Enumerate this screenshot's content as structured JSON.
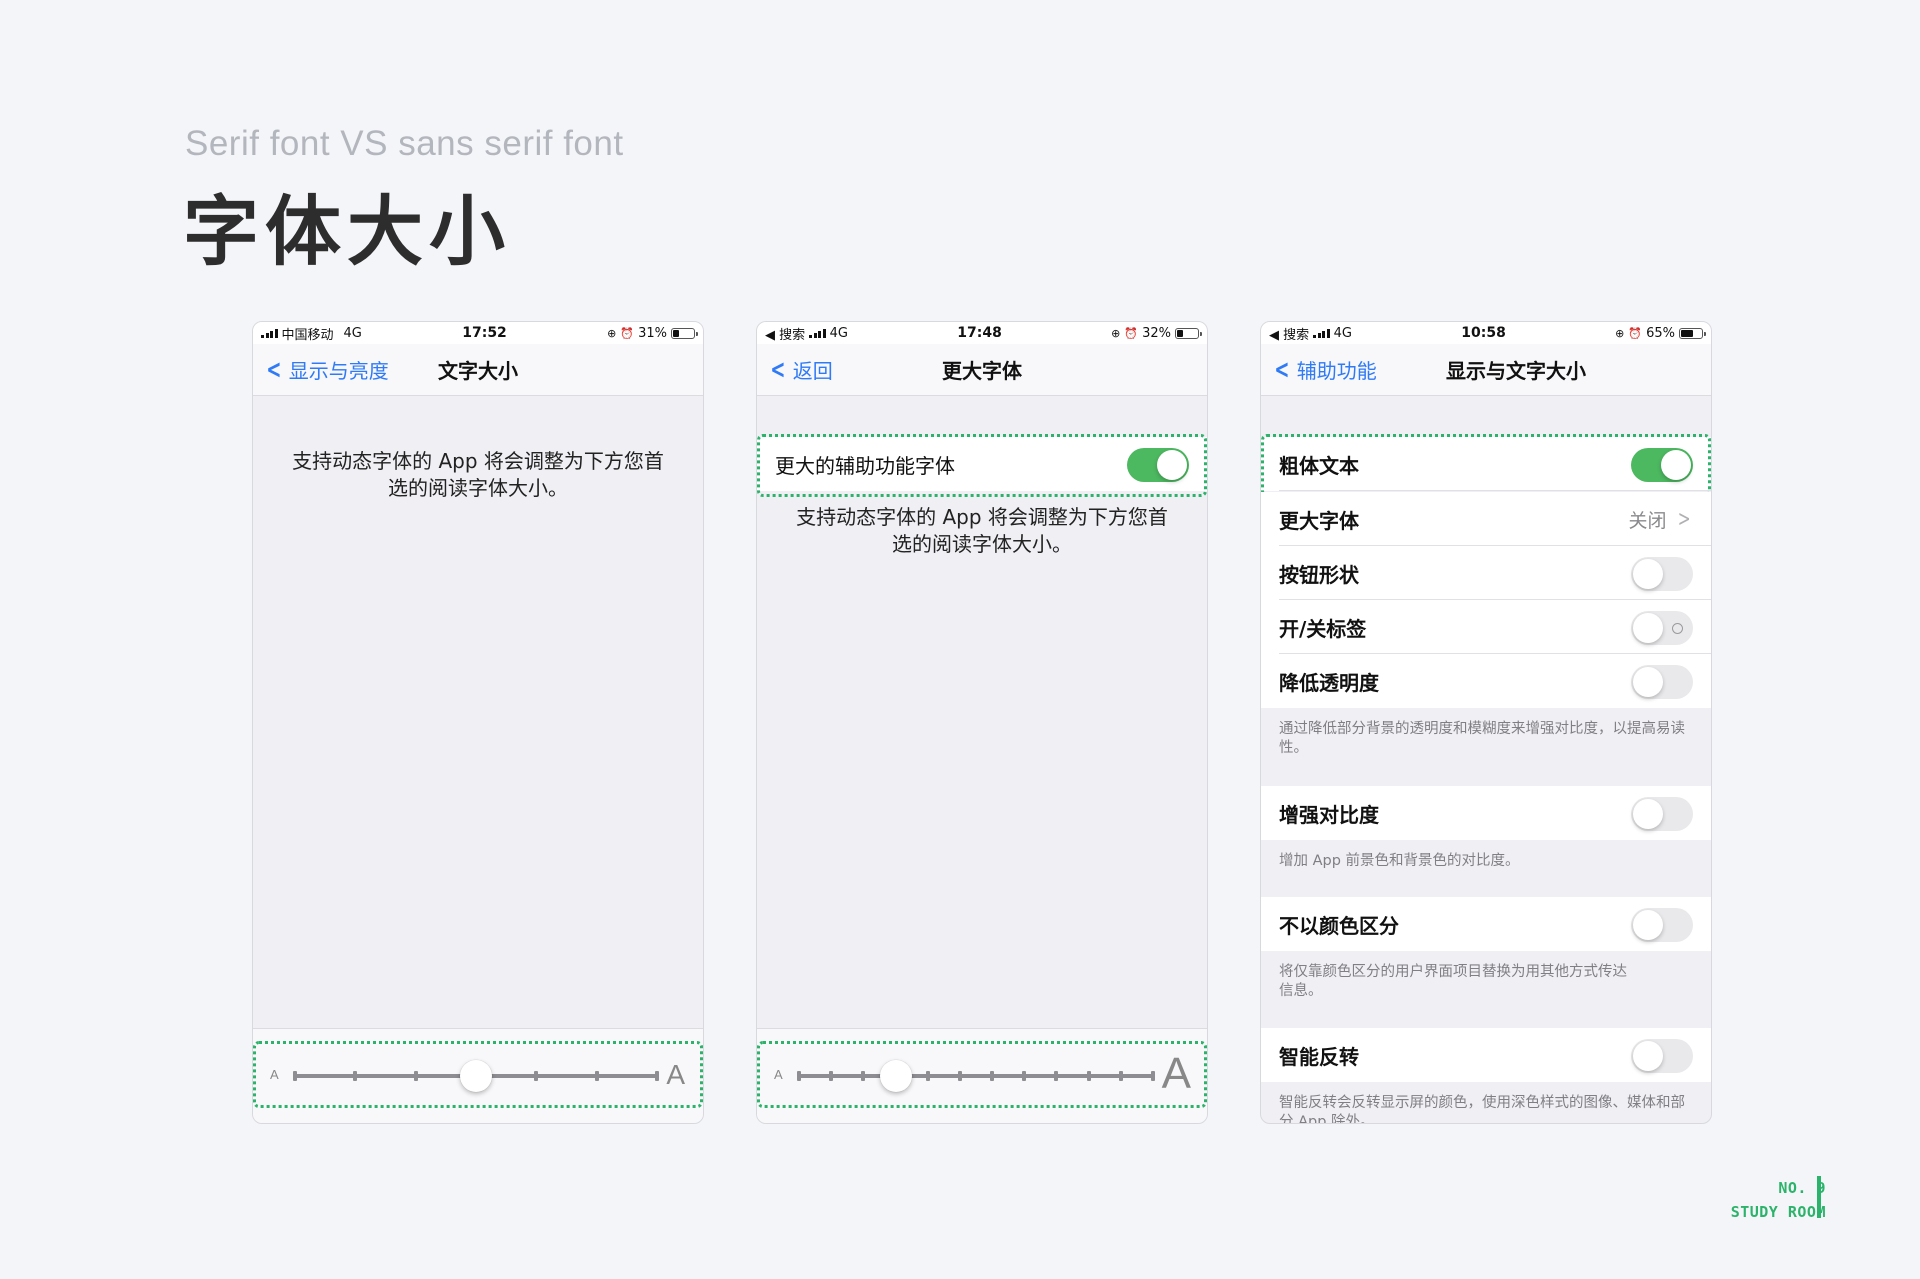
{
  "page": {
    "subtitle": "Serif font VS sans serif font",
    "title": "字体大小",
    "accent_color": "#2cb36b",
    "brand_line1": "NO. 9",
    "brand_line2": "STUDY ROOM"
  },
  "phone1": {
    "status": {
      "carrier": "中国移动",
      "network": "4G",
      "time": "17:52",
      "battery": "31%",
      "battery_level": 0.31
    },
    "nav": {
      "back_label": "显示与亮度",
      "title": "文字大小"
    },
    "description": "支持动态字体的 App 将会调整为下方您首选的阅读字体大小。",
    "slider": {
      "small_label": "A",
      "large_label": "A",
      "steps": 7,
      "value_step": 3
    }
  },
  "phone2": {
    "status": {
      "back_app": "◀ 搜索",
      "network": "4G",
      "time": "17:48",
      "battery": "32%",
      "battery_level": 0.32
    },
    "nav": {
      "back_label": "返回",
      "title": "更大字体"
    },
    "toggle_row": {
      "label": "更大的辅助功能字体",
      "on": true
    },
    "description": "支持动态字体的 App 将会调整为下方您首选的阅读字体大小。",
    "slider": {
      "small_label": "A",
      "large_label": "A",
      "steps": 12,
      "value_step": 3
    }
  },
  "phone3": {
    "status": {
      "back_app": "◀ 搜索",
      "network": "4G",
      "time": "10:58",
      "battery": "65%",
      "battery_level": 0.65
    },
    "nav": {
      "back_label": "辅助功能",
      "title": "显示与文字大小"
    },
    "rows": {
      "bold_text": {
        "label": "粗体文本",
        "on": true
      },
      "larger_text": {
        "label": "更大字体",
        "value": "关闭"
      },
      "button_shapes": {
        "label": "按钮形状",
        "on": false
      },
      "on_off_labels": {
        "label": "开/关标签",
        "on": false
      },
      "reduce_transparency": {
        "label": "降低透明度",
        "on": false
      },
      "increase_contrast": {
        "label": "增强对比度",
        "on": false
      },
      "differentiate_without_color": {
        "label": "不以颜色区分",
        "on": false
      },
      "smart_invert": {
        "label": "智能反转",
        "on": false
      }
    },
    "footers": {
      "reduce_transparency": "通过降低部分背景的透明度和模糊度来增强对比度，以提高易读性。",
      "increase_contrast": "增加 App 前景色和背景色的对比度。",
      "differentiate_without_color": "将仅靠颜色区分的用户界面项目替换为用其他方式传达信息。",
      "smart_invert": "智能反转会反转显示屏的颜色，使用深色样式的图像、媒体和部分 App 除外。"
    }
  },
  "icons": {
    "signal": "signal-bars-icon",
    "orientation_lock": "orientation-lock-icon",
    "alarm": "alarm-icon",
    "battery": "battery-icon",
    "back": "chevron-left-icon",
    "disclosure": "chevron-right-icon"
  }
}
